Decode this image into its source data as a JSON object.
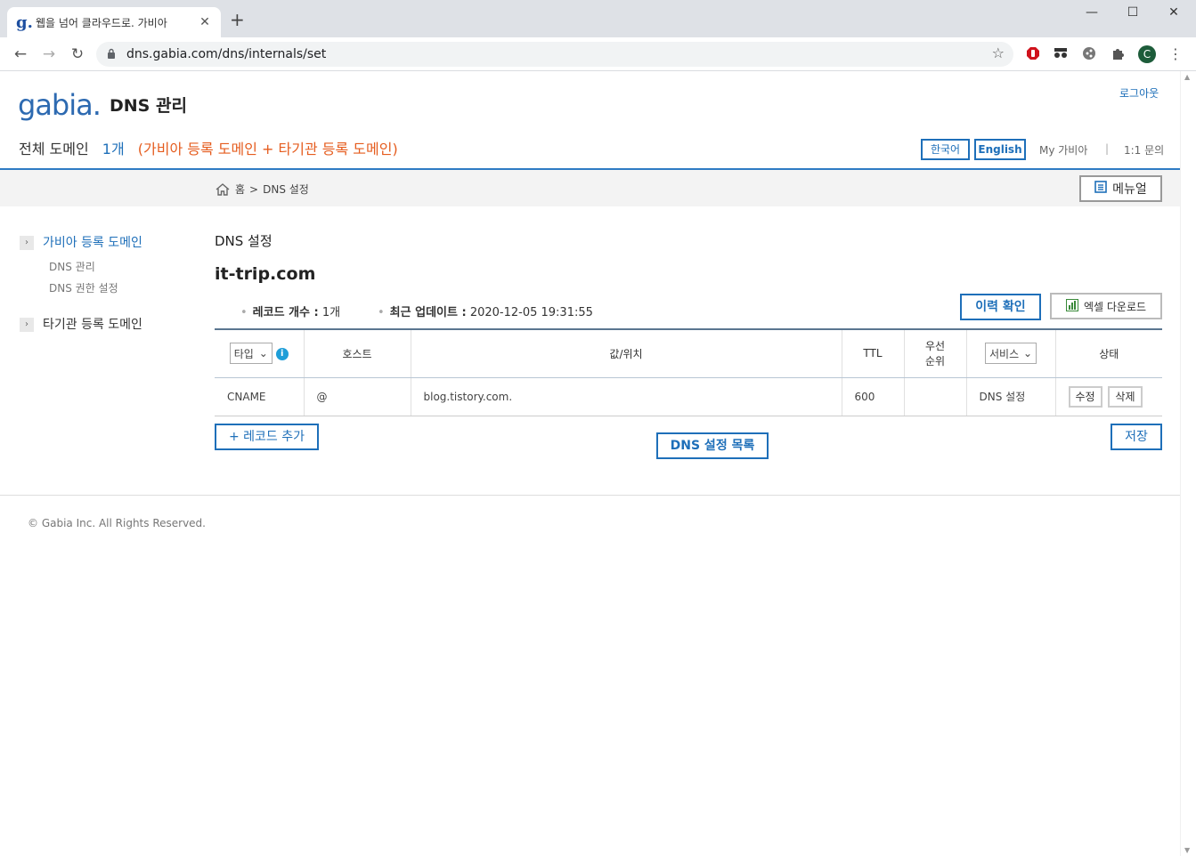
{
  "browser": {
    "tab_favicon": "g.",
    "tab_title": "웹을 넘어 클라우드로. 가비아",
    "new_tab": "+",
    "window_min": "—",
    "window_max": "☐",
    "window_close": "✕",
    "url": "dns.gabia.com/dns/internals/set",
    "profile_initial": "C"
  },
  "header": {
    "logo": "gabia.",
    "app_title": "DNS 관리",
    "logout": "로그아웃",
    "summary_label": "전체 도메인",
    "summary_count": "1개",
    "summary_desc": "(가비아 등록 도메인 + 타기관 등록 도메인)",
    "lang_ko": "한국어",
    "lang_en": "English",
    "my_gabia": "My 가비아",
    "separator": "|",
    "inquiry": "1:1 문의"
  },
  "breadcrumb": {
    "home": "홈",
    "sep": ">",
    "current": "DNS 설정"
  },
  "manual_button": "메뉴얼",
  "sidebar": {
    "group1": {
      "label": "가비아 등록 도메인",
      "items": [
        "DNS 관리",
        "DNS 권한 설정"
      ]
    },
    "group2": {
      "label": "타기관 등록 도메인"
    }
  },
  "main": {
    "section_title": "DNS 설정",
    "domain": "it-trip.com",
    "record_count_label": "레코드 개수 :",
    "record_count": "1개",
    "updated_label": "최근 업데이트 :",
    "updated_value": "2020-12-05 19:31:55",
    "history_button": "이력 확인",
    "excel_button": "엑셀 다운로드"
  },
  "table": {
    "type_select": "타입",
    "info_icon": "i",
    "col_host": "호스트",
    "col_value": "값/위치",
    "col_ttl": "TTL",
    "col_priority_1": "우선",
    "col_priority_2": "순위",
    "service_select": "서비스",
    "col_status": "상태",
    "rows": [
      {
        "type": "CNAME",
        "host": "@",
        "value": "blog.tistory.com.",
        "ttl": "600",
        "priority": "",
        "service": "DNS 설정",
        "edit": "수정",
        "delete": "삭제"
      }
    ]
  },
  "actions": {
    "add_record": "+ 레코드 추가",
    "dns_list": "DNS 설정 목록",
    "save": "저장"
  },
  "footer": {
    "copyright": "© Gabia Inc. All Rights Reserved."
  },
  "colors": {
    "brand_blue": "#1e6fb9",
    "accent_orange": "#e55c1e",
    "rule_blue": "#2e7bc4"
  }
}
